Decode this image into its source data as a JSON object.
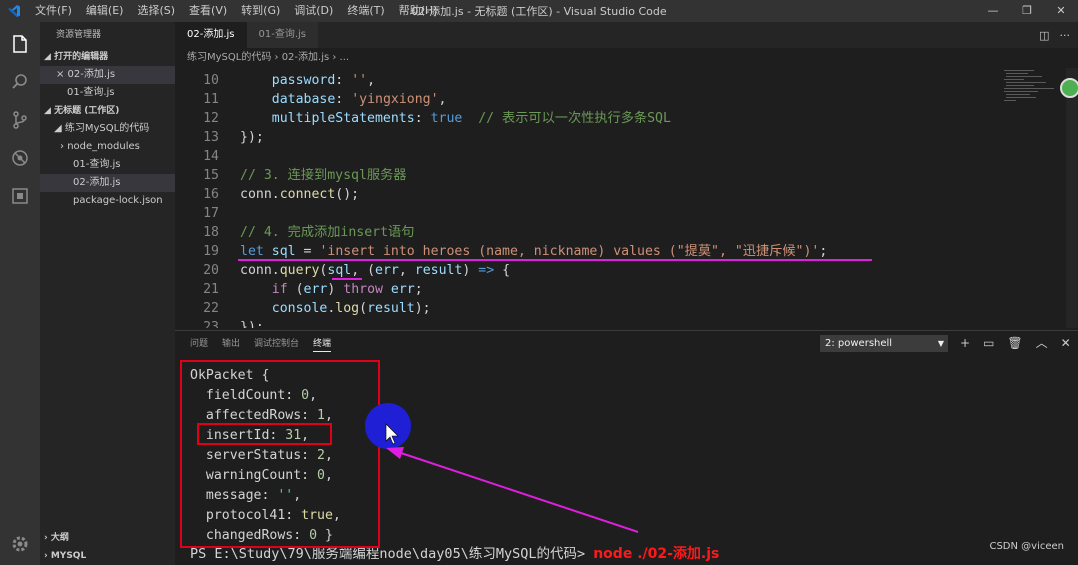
{
  "titlebar": {
    "menu": [
      "文件(F)",
      "编辑(E)",
      "选择(S)",
      "查看(V)",
      "转到(G)",
      "调试(D)",
      "终端(T)",
      "帮助(H)"
    ],
    "title": "02-添加.js - 无标题 (工作区) - Visual Studio Code",
    "controls": {
      "minimize": "—",
      "restore": "❐",
      "close": "✕"
    }
  },
  "sidebar": {
    "title": "资源管理器",
    "open_editors_label": "打开的编辑器",
    "open_editors": [
      "× 02-添加.js",
      "01-查询.js"
    ],
    "workspace_label": "无标题 (工作区)",
    "folder": "练习MySQL的代码",
    "items": [
      "node_modules",
      "01-查询.js",
      "02-添加.js",
      "package-lock.json"
    ],
    "outline_label": "大纲",
    "mysql_label": "MYSQL"
  },
  "tabs": [
    {
      "label": "02-添加.js",
      "active": true
    },
    {
      "label": "01-查询.js",
      "active": false
    }
  ],
  "breadcrumb": "练习MySQL的代码 › 02-添加.js › ...",
  "editor": {
    "lines": [
      {
        "n": "10",
        "tokens": [
          [
            "    ",
            "pl"
          ],
          [
            "password",
            "prop"
          ],
          [
            ": ",
            "pl"
          ],
          [
            "''",
            "str"
          ],
          [
            ",",
            "pl"
          ]
        ]
      },
      {
        "n": "11",
        "tokens": [
          [
            "    ",
            "pl"
          ],
          [
            "database",
            "prop"
          ],
          [
            ": ",
            "pl"
          ],
          [
            "'yingxiong'",
            "str"
          ],
          [
            ",",
            "pl"
          ]
        ]
      },
      {
        "n": "12",
        "tokens": [
          [
            "    ",
            "pl"
          ],
          [
            "multipleStatements",
            "prop"
          ],
          [
            ": ",
            "pl"
          ],
          [
            "true",
            "bool"
          ],
          [
            "  ",
            "pl"
          ],
          [
            "// 表示可以一次性执行多条SQL",
            "cmt"
          ]
        ]
      },
      {
        "n": "13",
        "tokens": [
          [
            "});",
            "pl"
          ]
        ]
      },
      {
        "n": "14",
        "tokens": []
      },
      {
        "n": "15",
        "tokens": [
          [
            "// 3. 连接到mysql服务器",
            "cmt"
          ]
        ]
      },
      {
        "n": "16",
        "tokens": [
          [
            "conn",
            "pl"
          ],
          [
            ".",
            "pl"
          ],
          [
            "connect",
            "fn"
          ],
          [
            "();",
            "pl"
          ]
        ]
      },
      {
        "n": "17",
        "tokens": []
      },
      {
        "n": "18",
        "tokens": [
          [
            "// 4. 完成添加insert语句",
            "cmt"
          ]
        ]
      },
      {
        "n": "19",
        "tokens": [
          [
            "let",
            "kw"
          ],
          [
            " ",
            "pl"
          ],
          [
            "sql",
            "prop"
          ],
          [
            " = ",
            "pl"
          ],
          [
            "'insert into heroes (name, nickname) values (\"提莫\", \"迅捷斥候\")'",
            "str"
          ],
          [
            ";",
            "pl"
          ]
        ]
      },
      {
        "n": "20",
        "tokens": [
          [
            "conn",
            "pl"
          ],
          [
            ".",
            "pl"
          ],
          [
            "query",
            "fn"
          ],
          [
            "(",
            "pl"
          ],
          [
            "sql",
            "prop"
          ],
          [
            ", (",
            "pl"
          ],
          [
            "err",
            "prop"
          ],
          [
            ", ",
            "pl"
          ],
          [
            "result",
            "prop"
          ],
          [
            ") ",
            "pl"
          ],
          [
            "=>",
            "kw"
          ],
          [
            " {",
            "pl"
          ]
        ]
      },
      {
        "n": "21",
        "tokens": [
          [
            "    ",
            "pl"
          ],
          [
            "if",
            "ctl"
          ],
          [
            " (",
            "pl"
          ],
          [
            "err",
            "prop"
          ],
          [
            ") ",
            "pl"
          ],
          [
            "throw",
            "ctl"
          ],
          [
            " ",
            "pl"
          ],
          [
            "err",
            "prop"
          ],
          [
            ";",
            "pl"
          ]
        ]
      },
      {
        "n": "22",
        "tokens": [
          [
            "    ",
            "pl"
          ],
          [
            "console",
            "prop"
          ],
          [
            ".",
            "pl"
          ],
          [
            "log",
            "fn"
          ],
          [
            "(",
            "pl"
          ],
          [
            "result",
            "prop"
          ],
          [
            ");",
            "pl"
          ]
        ]
      },
      {
        "n": "23",
        "tokens": [
          [
            "});",
            "pl"
          ]
        ]
      }
    ]
  },
  "panel": {
    "tabs": [
      "问题",
      "输出",
      "调试控制台",
      "终端"
    ],
    "active_tab": "终端",
    "terminal_select": "2: powershell",
    "actions": [
      "+",
      "▭",
      "🗑",
      "︿",
      "✕"
    ]
  },
  "terminal": {
    "lines": [
      [
        [
          "OkPacket {",
          "pl"
        ]
      ],
      [
        [
          "  fieldCount: ",
          "pl"
        ],
        [
          "0",
          "num"
        ],
        [
          ",",
          "pl"
        ]
      ],
      [
        [
          "  affectedRows: ",
          "pl"
        ],
        [
          "1",
          "num"
        ],
        [
          ",",
          "pl"
        ]
      ],
      [
        [
          "  insertId: ",
          "pl"
        ],
        [
          "31",
          "num"
        ],
        [
          ",",
          "pl"
        ]
      ],
      [
        [
          "  serverStatus: ",
          "pl"
        ],
        [
          "2",
          "num"
        ],
        [
          ",",
          "pl"
        ]
      ],
      [
        [
          "  warningCount: ",
          "pl"
        ],
        [
          "0",
          "num"
        ],
        [
          ",",
          "pl"
        ]
      ],
      [
        [
          "  message: ",
          "pl"
        ],
        [
          "''",
          "tstr"
        ],
        [
          ",",
          "pl"
        ]
      ],
      [
        [
          "  protocol41: ",
          "pl"
        ],
        [
          "true",
          "tbool"
        ],
        [
          ",",
          "pl"
        ]
      ],
      [
        [
          "  changedRows: ",
          "pl"
        ],
        [
          "0",
          "num"
        ],
        [
          " }",
          "pl"
        ]
      ]
    ],
    "prompt": "PS E:\\Study\\79\\服务端编程node\\day05\\练习MySQL的代码> ",
    "command": "node ./02-添加.js"
  },
  "watermark": "CSDN @viceen",
  "colors": {
    "annotation_red": "#e0001a",
    "annotation_magenta": "#e01ee0",
    "cursor_blue": "#1f1fd6"
  }
}
